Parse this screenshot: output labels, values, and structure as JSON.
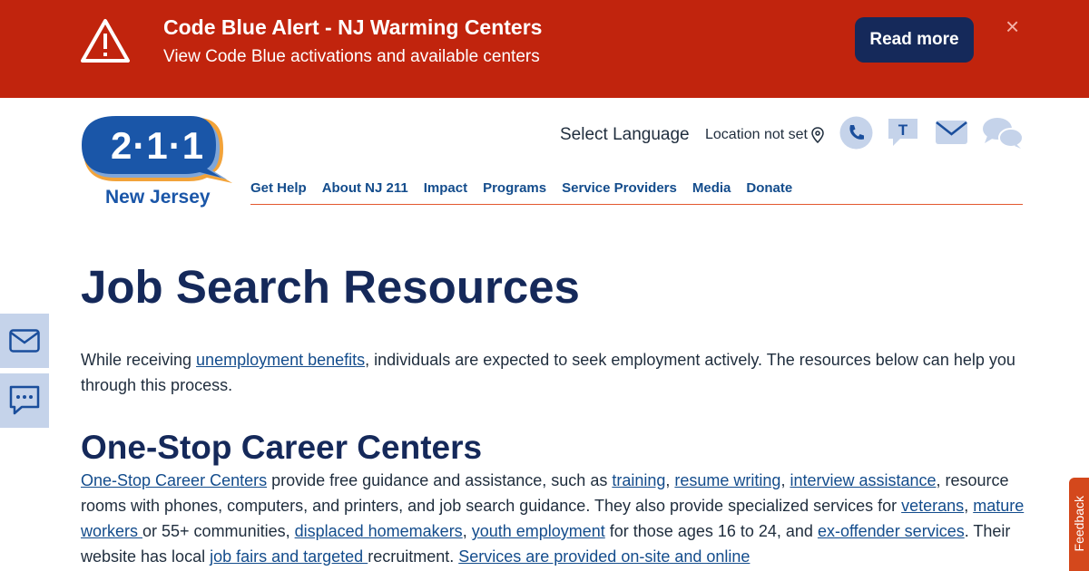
{
  "alert": {
    "title": "Code Blue Alert - NJ Warming Centers",
    "subtitle": "View Code Blue activations and available centers",
    "button": "Read more",
    "close": "×"
  },
  "logo": {
    "number": "2·1·1",
    "region": "New Jersey"
  },
  "header": {
    "language": "Select Language",
    "location": "Location not set"
  },
  "nav": [
    "Get Help",
    "About NJ 211",
    "Impact",
    "Programs",
    "Service Providers",
    "Media",
    "Donate"
  ],
  "main": {
    "title": "Job Search Resources",
    "intro": {
      "t1": "While receiving ",
      "l1": "unemployment benefits",
      "t2": ", individuals are expected to seek employment actively. The resources below can help you through this process."
    },
    "section_title": "One-Stop Career Centers",
    "body": {
      "l1": "One-Stop Career Centers",
      "t1": " provide free guidance and assistance, such as ",
      "l2": "training",
      "t2": ", ",
      "l3": "resume writing",
      "t3": ", ",
      "l4": "interview assistance",
      "t4": ", resource rooms with phones, computers, and printers, and job search guidance. They also provide specialized services for ",
      "l5": "veterans",
      "t5": ", ",
      "l6": "mature workers ",
      "t6": "or 55+ communities, ",
      "l7": "displaced homemakers",
      "t7": ", ",
      "l8": "youth employment",
      "t8": " for those ages 16 to 24, and ",
      "l9": "ex-offender services",
      "t9": ". Their website has local ",
      "l10": "job fairs and targeted ",
      "t10": "recruitment. ",
      "l11": "Services are provided on-site and online"
    }
  },
  "feedback": "Feedback",
  "colors": {
    "alert_bg": "#c1240d",
    "navy": "#15295a",
    "link": "#134c8c",
    "accent": "#e2582e",
    "icon_bg": "#c5d3ea"
  }
}
